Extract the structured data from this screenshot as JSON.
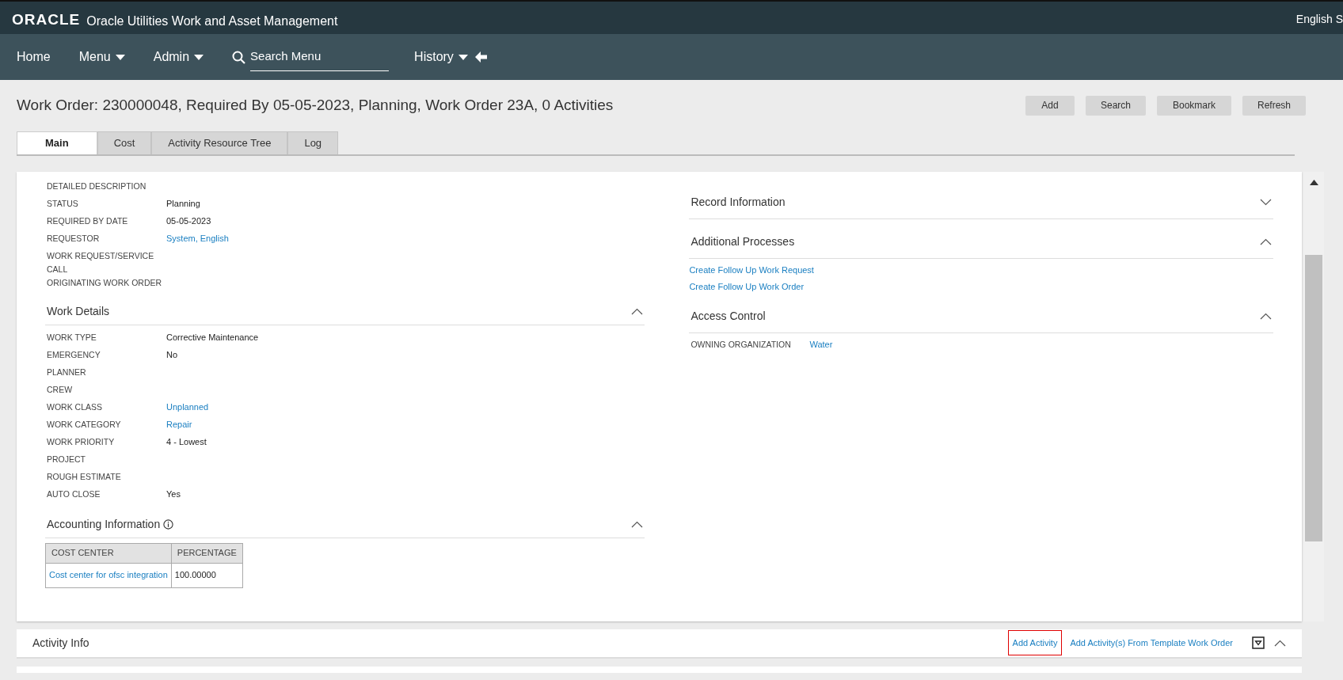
{
  "header": {
    "brand": "ORACLE",
    "app_title": "Oracle Utilities Work and Asset Management",
    "user": "English S"
  },
  "nav": {
    "items": [
      {
        "label": "Home",
        "dropdown": false
      },
      {
        "label": "Menu",
        "dropdown": true
      },
      {
        "label": "Admin",
        "dropdown": true
      }
    ],
    "search": {
      "placeholder": "Search Menu"
    },
    "history": {
      "label": "History",
      "dropdown": true
    }
  },
  "page_title": "Work Order: 230000048, Required By 05-05-2023, Planning, Work Order 23A, 0 Activities",
  "actions": [
    "Add",
    "Search",
    "Bookmark",
    "Refresh"
  ],
  "tabs": [
    {
      "label": "Main",
      "selected": true
    },
    {
      "label": "Cost",
      "selected": false
    },
    {
      "label": "Activity Resource Tree",
      "selected": false
    },
    {
      "label": "Log",
      "selected": false
    }
  ],
  "main_fields": [
    {
      "label": "DETAILED DESCRIPTION"
    },
    {
      "label": "STATUS",
      "value": "Planning",
      "kind": "text"
    },
    {
      "label": "REQUIRED BY DATE",
      "value": "05-05-2023",
      "kind": "text"
    },
    {
      "label": "REQUESTOR",
      "value": "System, English",
      "kind": "link"
    },
    {
      "label": "WORK REQUEST/SERVICE CALL"
    },
    {
      "label": "ORIGINATING WORK ORDER"
    }
  ],
  "work_details": {
    "title": "Work Details",
    "expanded": true,
    "fields": [
      {
        "label": "WORK TYPE",
        "value": "Corrective Maintenance",
        "kind": "text"
      },
      {
        "label": "EMERGENCY",
        "value": "No",
        "kind": "text"
      },
      {
        "label": "PLANNER"
      },
      {
        "label": "CREW"
      },
      {
        "label": "WORK CLASS",
        "value": "Unplanned",
        "kind": "link"
      },
      {
        "label": "WORK CATEGORY",
        "value": "Repair",
        "kind": "link"
      },
      {
        "label": "WORK PRIORITY",
        "value": "4 - Lowest",
        "kind": "text"
      },
      {
        "label": "PROJECT"
      },
      {
        "label": "ROUGH ESTIMATE"
      },
      {
        "label": "AUTO CLOSE",
        "value": "Yes",
        "kind": "text"
      }
    ]
  },
  "accounting": {
    "title": "Accounting Information",
    "expanded": true,
    "table": {
      "columns": [
        "COST CENTER",
        "PERCENTAGE"
      ],
      "rows": [
        [
          "Cost center for ofsc integration",
          "100.00000"
        ]
      ]
    }
  },
  "record_information": {
    "title": "Record Information",
    "expanded": false
  },
  "additional_processes": {
    "title": "Additional Processes",
    "expanded": true,
    "links": [
      "Create Follow Up Work Request",
      "Create Follow Up Work Order"
    ]
  },
  "access_control": {
    "title": "Access Control",
    "expanded": true,
    "fields": [
      {
        "label": "OWNING ORGANIZATION",
        "value": "Water",
        "kind": "link"
      }
    ]
  },
  "activity_info": {
    "title": "Activity Info",
    "expanded": true,
    "links": [
      {
        "label": "Add Activity",
        "highlighted": true
      },
      {
        "label": "Add Activity(s) From Template Work Order",
        "highlighted": false
      }
    ]
  }
}
